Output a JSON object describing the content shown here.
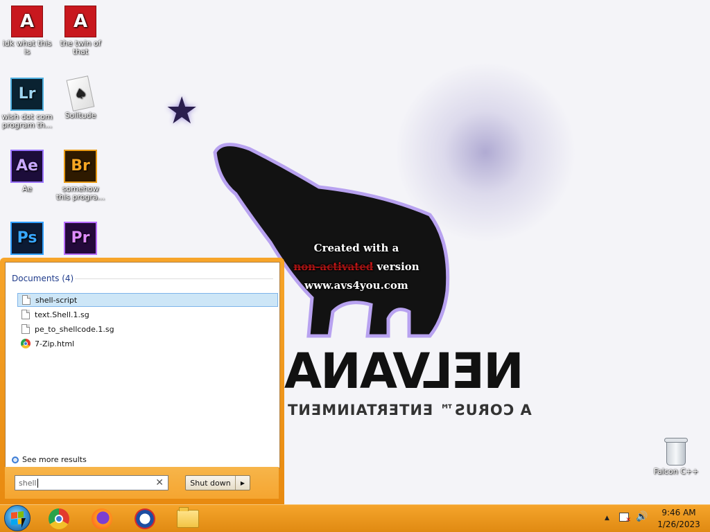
{
  "desktop": {
    "icons": [
      {
        "glyph": "A",
        "label": "idk what this is",
        "icon": "acrobat-icon"
      },
      {
        "glyph": "A",
        "label": "the twin of that",
        "icon": "acrobat-icon"
      },
      {
        "glyph": "Lr",
        "label": "wish dot com program th...",
        "icon": "lightroom-icon"
      },
      {
        "glyph": "♠",
        "label": "Solitude",
        "icon": "solitaire-icon"
      },
      {
        "glyph": "Ae",
        "label": "Ae",
        "icon": "after-effects-icon"
      },
      {
        "glyph": "Br",
        "label": "somehow this progra...",
        "icon": "bridge-icon"
      },
      {
        "glyph": "Ps",
        "label": "",
        "icon": "photoshop-icon"
      },
      {
        "glyph": "Pr",
        "label": "",
        "icon": "premiere-icon"
      }
    ],
    "recycle_bin": {
      "label": "Falcon C++",
      "icon": "recycle-bin-icon"
    }
  },
  "wallpaper": {
    "watermark_line1": "Created with a",
    "watermark_line2_red": "non-activated",
    "watermark_line2_rest": " version",
    "watermark_line3": "www.avs4you.com",
    "logo_text": "NELVANA",
    "logo_sub": "A CORUS™ ENTERTAINMENT",
    "star_glyph": "★"
  },
  "start_menu": {
    "section_title": "Documents (4)",
    "results": [
      {
        "label": "shell-script",
        "icon": "document-icon",
        "selected": true
      },
      {
        "label": "text.Shell.1.sg",
        "icon": "document-icon",
        "selected": false
      },
      {
        "label": "pe_to_shellcode.1.sg",
        "icon": "document-icon",
        "selected": false
      },
      {
        "label": "7-Zip.html",
        "icon": "chrome-icon",
        "selected": false
      }
    ],
    "see_more": "See more results",
    "search_value": "shell",
    "clear_glyph": "✕",
    "shutdown_label": "Shut down",
    "shutdown_arrow": "▶"
  },
  "taskbar": {
    "pinned": [
      "chrome-icon",
      "firefox-icon",
      "opera-icon",
      "file-explorer-icon"
    ],
    "tray_arrow": "▲",
    "volume_glyph": "🔊",
    "time": "9:46 AM",
    "date": "1/26/2023"
  },
  "colors": {
    "taskbar": "#f5a42b",
    "selection": "#cde6f7",
    "section_title": "#1e3a8a"
  }
}
